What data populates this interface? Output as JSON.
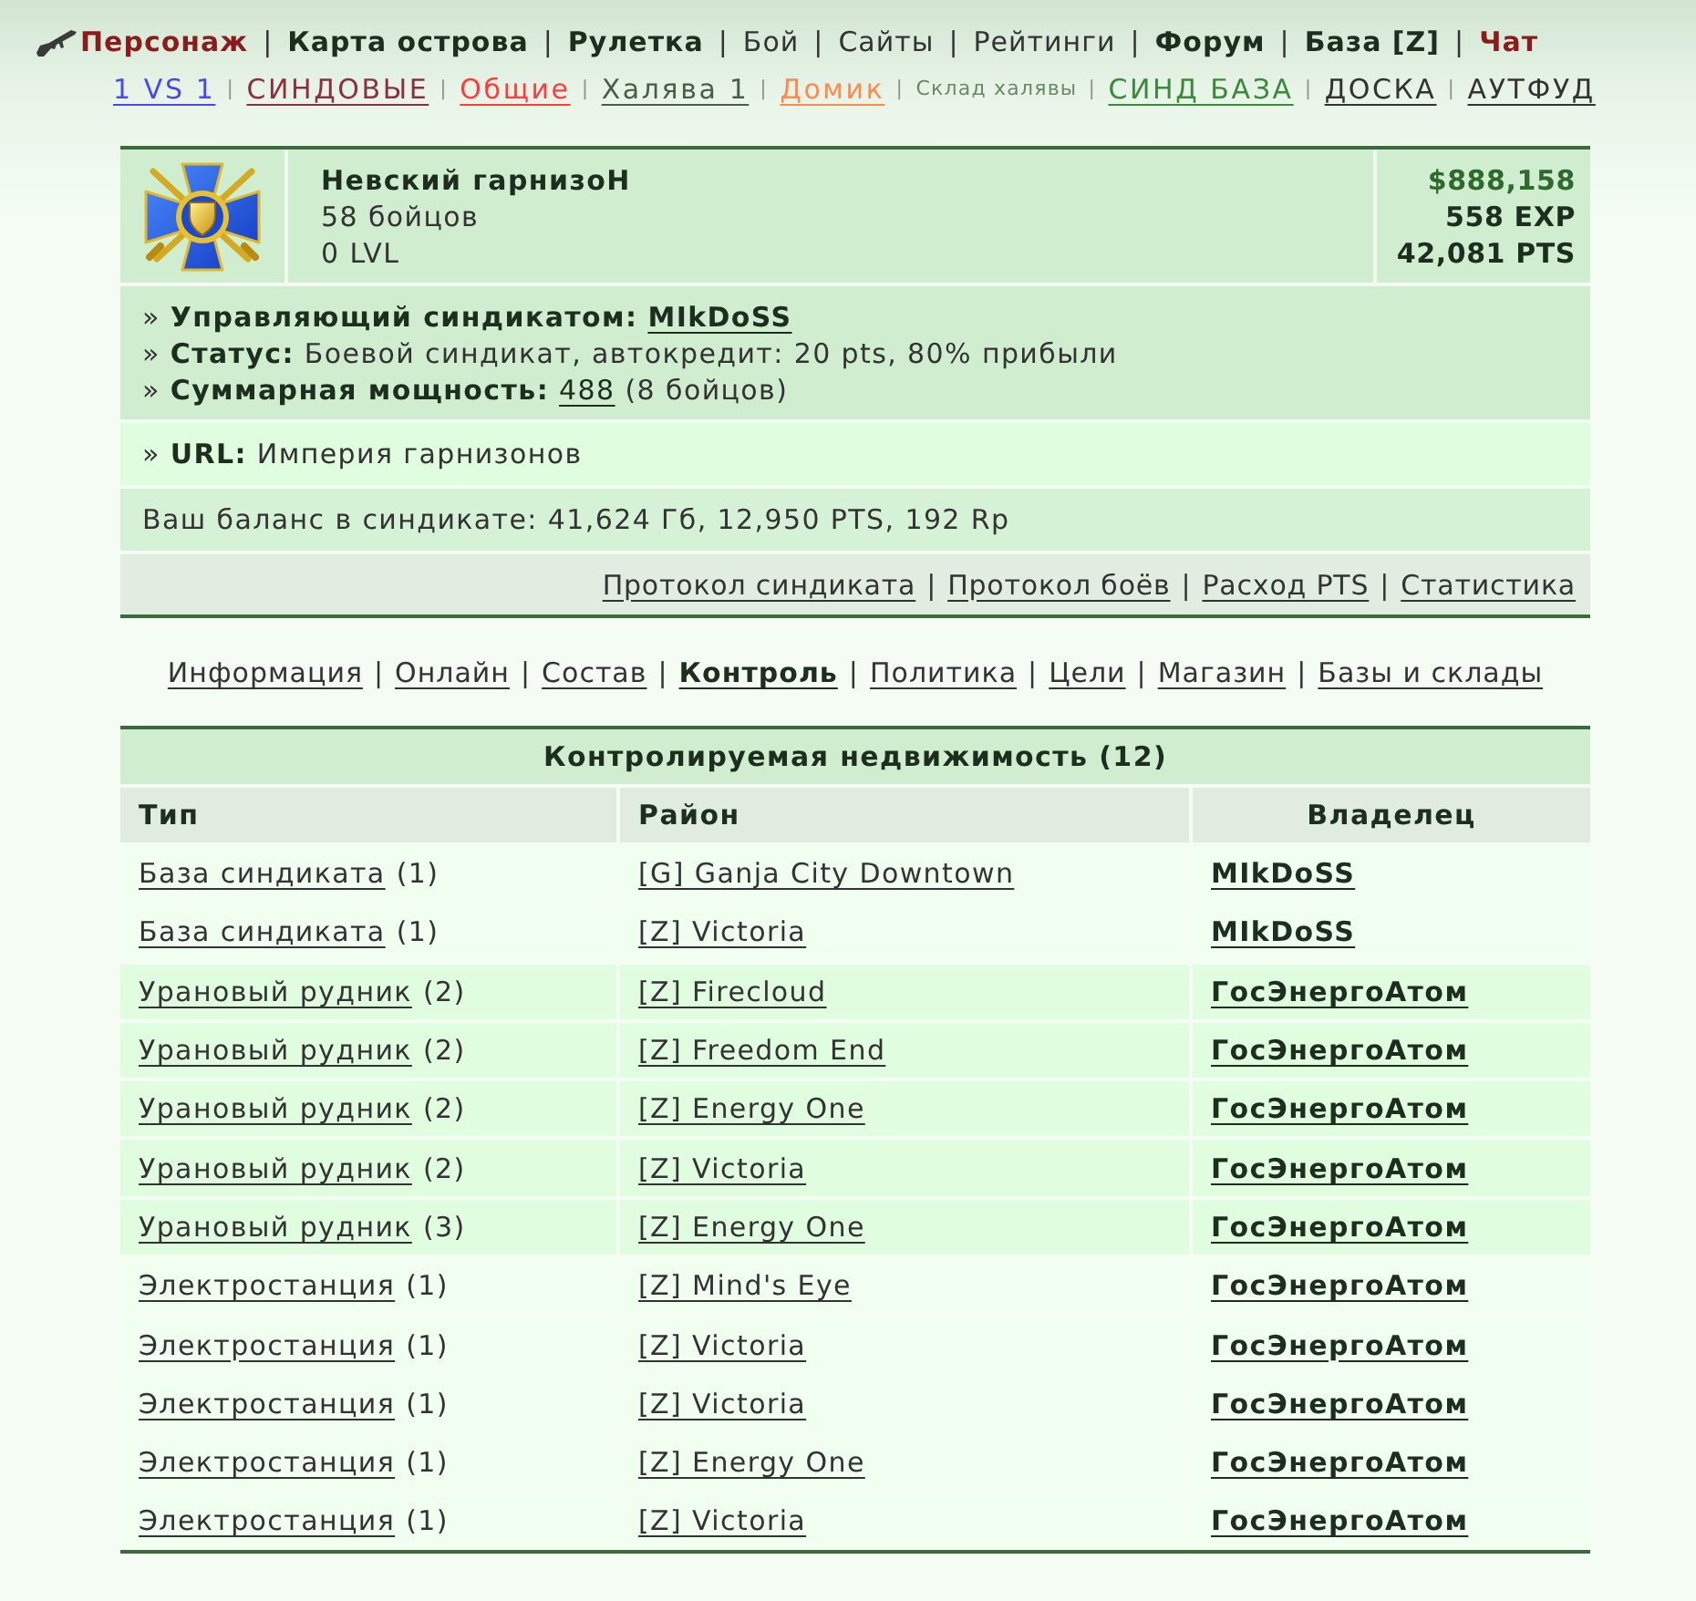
{
  "top_nav": [
    {
      "separator": "|",
      "items": [
        {
          "label": "Персонаж",
          "kind": "menu",
          "bold": true,
          "color": "#8b1c1c"
        },
        {
          "label": "Карта острова",
          "kind": "menu",
          "bold": true,
          "color": "#1c2e1c"
        },
        {
          "label": "Рулетка",
          "kind": "menu",
          "bold": true,
          "color": "#1c2e1c"
        },
        {
          "label": "Бой",
          "kind": "menu",
          "bold": false,
          "color": "#333333"
        },
        {
          "label": "Сайты",
          "kind": "menu",
          "bold": false,
          "color": "#333333"
        },
        {
          "label": "Рейтинги",
          "kind": "menu",
          "bold": false,
          "color": "#333333"
        },
        {
          "label": "Форум",
          "kind": "menu",
          "bold": true,
          "color": "#1c2e1c"
        },
        {
          "label": "База [Z]",
          "kind": "menu",
          "bold": true,
          "color": "#1c2e1c"
        },
        {
          "label": "Чат",
          "kind": "menu",
          "bold": true,
          "color": "#8b1c1c"
        }
      ]
    },
    {
      "separator": "|",
      "items": [
        {
          "label": "1 VS 1",
          "kind": "link",
          "color": "#4848ee"
        },
        {
          "label": "СИНДОВЫЕ",
          "kind": "link",
          "color": "#8a3040"
        },
        {
          "label": "Общие",
          "kind": "link",
          "color": "#ff3c3c"
        },
        {
          "label": "Халява 1",
          "kind": "link",
          "color": "#475f47"
        },
        {
          "label": "Домик",
          "kind": "link",
          "color": "#ff8a4c"
        },
        {
          "label": "Склад халявы",
          "kind": "note",
          "color": "#6a8a6a"
        },
        {
          "label": "СИНД БАЗА",
          "kind": "link",
          "color": "#3a8a3a"
        },
        {
          "label": "ДОСКА",
          "kind": "link",
          "color": "#333333"
        },
        {
          "label": "АУТФУД",
          "kind": "link",
          "color": "#333333"
        }
      ]
    }
  ],
  "syndicate": {
    "name": "Невский гарнизоН",
    "members": "58 бойцов",
    "level": "0 LVL",
    "money": "$888,158",
    "exp": "558 EXP",
    "pts": "42,081 PTS",
    "info": [
      [
        {
          "kind": "text",
          "text": "» **Управляющий синдикатом:**"
        },
        {
          "kind": "link",
          "text": "MIkDoSS",
          "bold": true
        }
      ],
      [
        {
          "kind": "text",
          "text": "» **Статус:** Боевой синдикат, автокредит: 20 pts, 80% прибыли"
        }
      ],
      [
        {
          "kind": "text",
          "text": "» **Суммарная мощность:**"
        },
        {
          "kind": "link",
          "text": "488",
          "bold": false
        },
        {
          "kind": "text",
          "text": "(8 бойцов)"
        }
      ]
    ],
    "url": "» **URL:** Империя гарнизонов",
    "balance": "Ваш баланс в синдикате: 41,624 Гб, 12,950 PTS, 192 Rp",
    "links": {
      "separator": "|",
      "items": [
        "Протокол синдиката",
        "Протокол боёв",
        "Расход PTS",
        "Статистика"
      ]
    }
  },
  "sections": {
    "separator": "|",
    "items": [
      {
        "label": "Информация",
        "selected": false
      },
      {
        "label": "Онлайн",
        "selected": false
      },
      {
        "label": "Состав",
        "selected": false
      },
      {
        "label": "Контроль",
        "selected": true
      },
      {
        "label": "Политика",
        "selected": false
      },
      {
        "label": "Цели",
        "selected": false
      },
      {
        "label": "Магазин",
        "selected": false
      },
      {
        "label": "Базы и склады",
        "selected": false
      }
    ]
  },
  "table": {
    "title": "Контролируемая недвижимость (12)",
    "columns": [
      "Тип",
      "Район",
      "Владелец"
    ],
    "rows": [
      {
        "type": "База синдиката",
        "count": "(1)",
        "district": "[G] Ganja City Downtown",
        "owner": "MIkDoSS",
        "highlighted": false
      },
      {
        "type": "База синдиката",
        "count": "(1)",
        "district": "[Z] Victoria",
        "owner": "MIkDoSS",
        "highlighted": false
      },
      {
        "type": "Урановый рудник",
        "count": "(2)",
        "district": "[Z] Firecloud",
        "owner": "ГосЭнергоАтом",
        "highlighted": true
      },
      {
        "type": "Урановый рудник",
        "count": "(2)",
        "district": "[Z] Freedom End",
        "owner": "ГосЭнергоАтом",
        "highlighted": true
      },
      {
        "type": "Урановый рудник",
        "count": "(2)",
        "district": "[Z] Energy One",
        "owner": "ГосЭнергоАтом",
        "highlighted": true
      },
      {
        "type": "Урановый рудник",
        "count": "(2)",
        "district": "[Z] Victoria",
        "owner": "ГосЭнергоАтом",
        "highlighted": true
      },
      {
        "type": "Урановый рудник",
        "count": "(3)",
        "district": "[Z] Energy One",
        "owner": "ГосЭнергоАтом",
        "highlighted": true
      },
      {
        "type": "Электростанция",
        "count": "(1)",
        "district": "[Z] Mind's Eye",
        "owner": "ГосЭнергоАтом",
        "highlighted": false
      },
      {
        "type": "Электростанция",
        "count": "(1)",
        "district": "[Z] Victoria",
        "owner": "ГосЭнергоАтом",
        "highlighted": false
      },
      {
        "type": "Электростанция",
        "count": "(1)",
        "district": "[Z] Victoria",
        "owner": "ГосЭнергоАтом",
        "highlighted": false
      },
      {
        "type": "Электростанция",
        "count": "(1)",
        "district": "[Z] Energy One",
        "owner": "ГосЭнергоАтом",
        "highlighted": false
      },
      {
        "type": "Электростанция",
        "count": "(1)",
        "district": "[Z] Victoria",
        "owner": "ГосЭнергоАтом",
        "highlighted": false
      }
    ]
  }
}
